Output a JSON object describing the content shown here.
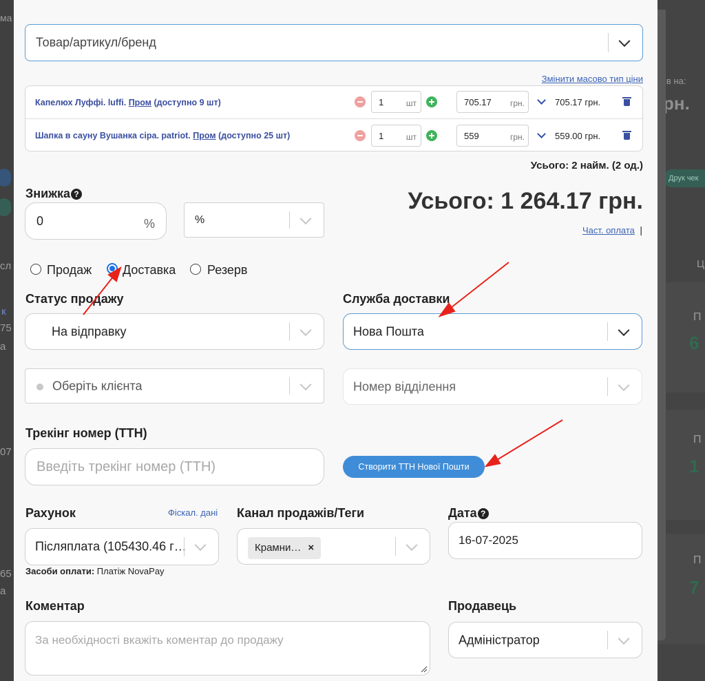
{
  "background": {
    "left_edge_text": "ма",
    "right_header": "ів на:",
    "right_big": "рн.",
    "pill_right": "Друк чек",
    "green_values": [
      "6",
      "1",
      "7"
    ],
    "gray_letters": [
      "П",
      "П",
      "П"
    ],
    "left_snippets": [
      "сл",
      "к",
      "75",
      "а",
      "07",
      "65",
      "а",
      "Ц"
    ]
  },
  "product_search": {
    "placeholder": "Товар/артикул/бренд"
  },
  "bulk_price_link": "Змінити масово тип ціни",
  "products": [
    {
      "name": "Капелюх Луффі. luffi.",
      "source": "Пром",
      "availability": "(доступно 9 шт)",
      "qty": "1",
      "unit": "шт",
      "price": "705.17",
      "currency": "грн.",
      "sum": "705.17 грн."
    },
    {
      "name": "Шапка в сауну Вушанка сіра. patriot.",
      "source": "Пром",
      "availability": "(доступно 25 шт)",
      "qty": "1",
      "unit": "шт",
      "price": "559",
      "currency": "грн.",
      "sum": "559.00 грн."
    }
  ],
  "totals": {
    "items_summary": "Усього: 2 найм. (2 од.)",
    "grand_total": "Усього: 1 264.17 грн.",
    "partial_payment_link": "Част. оплата",
    "partial_sep": "|"
  },
  "discount": {
    "label": "Знижка",
    "help": "?",
    "value": "0",
    "suffix": "%",
    "type_value": "%"
  },
  "sale_type": {
    "options": [
      "Продаж",
      "Доставка",
      "Резерв"
    ],
    "selected": "Доставка"
  },
  "sale_status": {
    "label": "Статус продажу",
    "value": "На відправку"
  },
  "delivery_service": {
    "label": "Служба доставки",
    "value": "Нова Пошта"
  },
  "client": {
    "placeholder": "Оберіть клієнта"
  },
  "branch": {
    "placeholder": "Номер відділення"
  },
  "tracking": {
    "label": "Трекінг номер (ТТН)",
    "placeholder": "Введіть трекінг номер (ТТН)",
    "create_button": "Створити ТТН Нової Пошти"
  },
  "account": {
    "label": "Рахунок",
    "fiscal_link": "Фіскал. дані",
    "value": "Післяплата (105430.46 г…",
    "payment_means_label": "Засоби оплати:",
    "payment_means_value": "Платіж NovaPay"
  },
  "channel": {
    "label": "Канал продажів/Теги",
    "tag": "Крамни…",
    "tag_remove": "×"
  },
  "date": {
    "label": "Дата",
    "help": "?",
    "value": "16-07-2025"
  },
  "comment": {
    "label": "Коментар",
    "placeholder": "За необхідності вкажіть коментар до продажу"
  },
  "seller": {
    "label": "Продавець",
    "value": "Адміністратор"
  },
  "colors": {
    "accent": "#3f8dd8",
    "link": "#3b63b7",
    "annotation_arrow": "#e8221b"
  }
}
